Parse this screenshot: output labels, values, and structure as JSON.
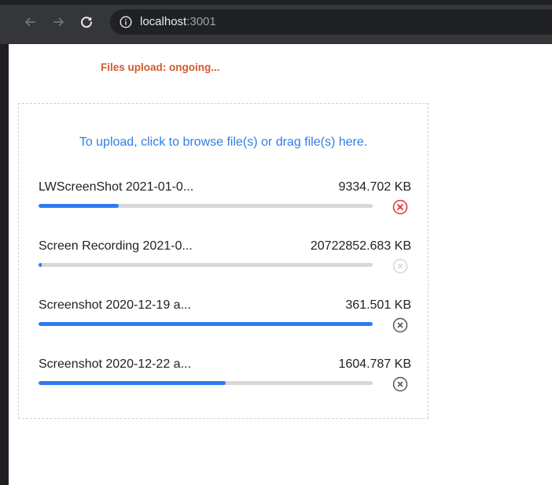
{
  "browser": {
    "url_host": "localhost",
    "url_port": ":3001"
  },
  "status": {
    "label": "Files upload: ongoing...",
    "color": "#d35a2e"
  },
  "dropzone": {
    "prompt": "To upload, click to browse file(s) or drag file(s) here."
  },
  "files": [
    {
      "name": "LWScreenShot 2021-01-0...",
      "size": "9334.702 KB",
      "progress": 0.24,
      "cancel_state": "active"
    },
    {
      "name": "Screen Recording 2021-0...",
      "size": "20722852.683 KB",
      "progress": 0.01,
      "cancel_state": "disabled"
    },
    {
      "name": "Screenshot 2020-12-19 a...",
      "size": "361.501 KB",
      "progress": 1.0,
      "cancel_state": "normal"
    },
    {
      "name": "Screenshot 2020-12-22 a...",
      "size": "1604.787 KB",
      "progress": 0.56,
      "cancel_state": "normal"
    }
  ],
  "colors": {
    "accent": "#2f7bef",
    "cancel_active": "#e0302f",
    "cancel_normal": "#555555",
    "cancel_disabled": "#d6d6d6"
  },
  "icons": {
    "back": "arrow-left-icon",
    "forward": "arrow-right-icon",
    "reload": "reload-icon",
    "info": "info-icon",
    "cancel": "cancel-circle-icon"
  }
}
